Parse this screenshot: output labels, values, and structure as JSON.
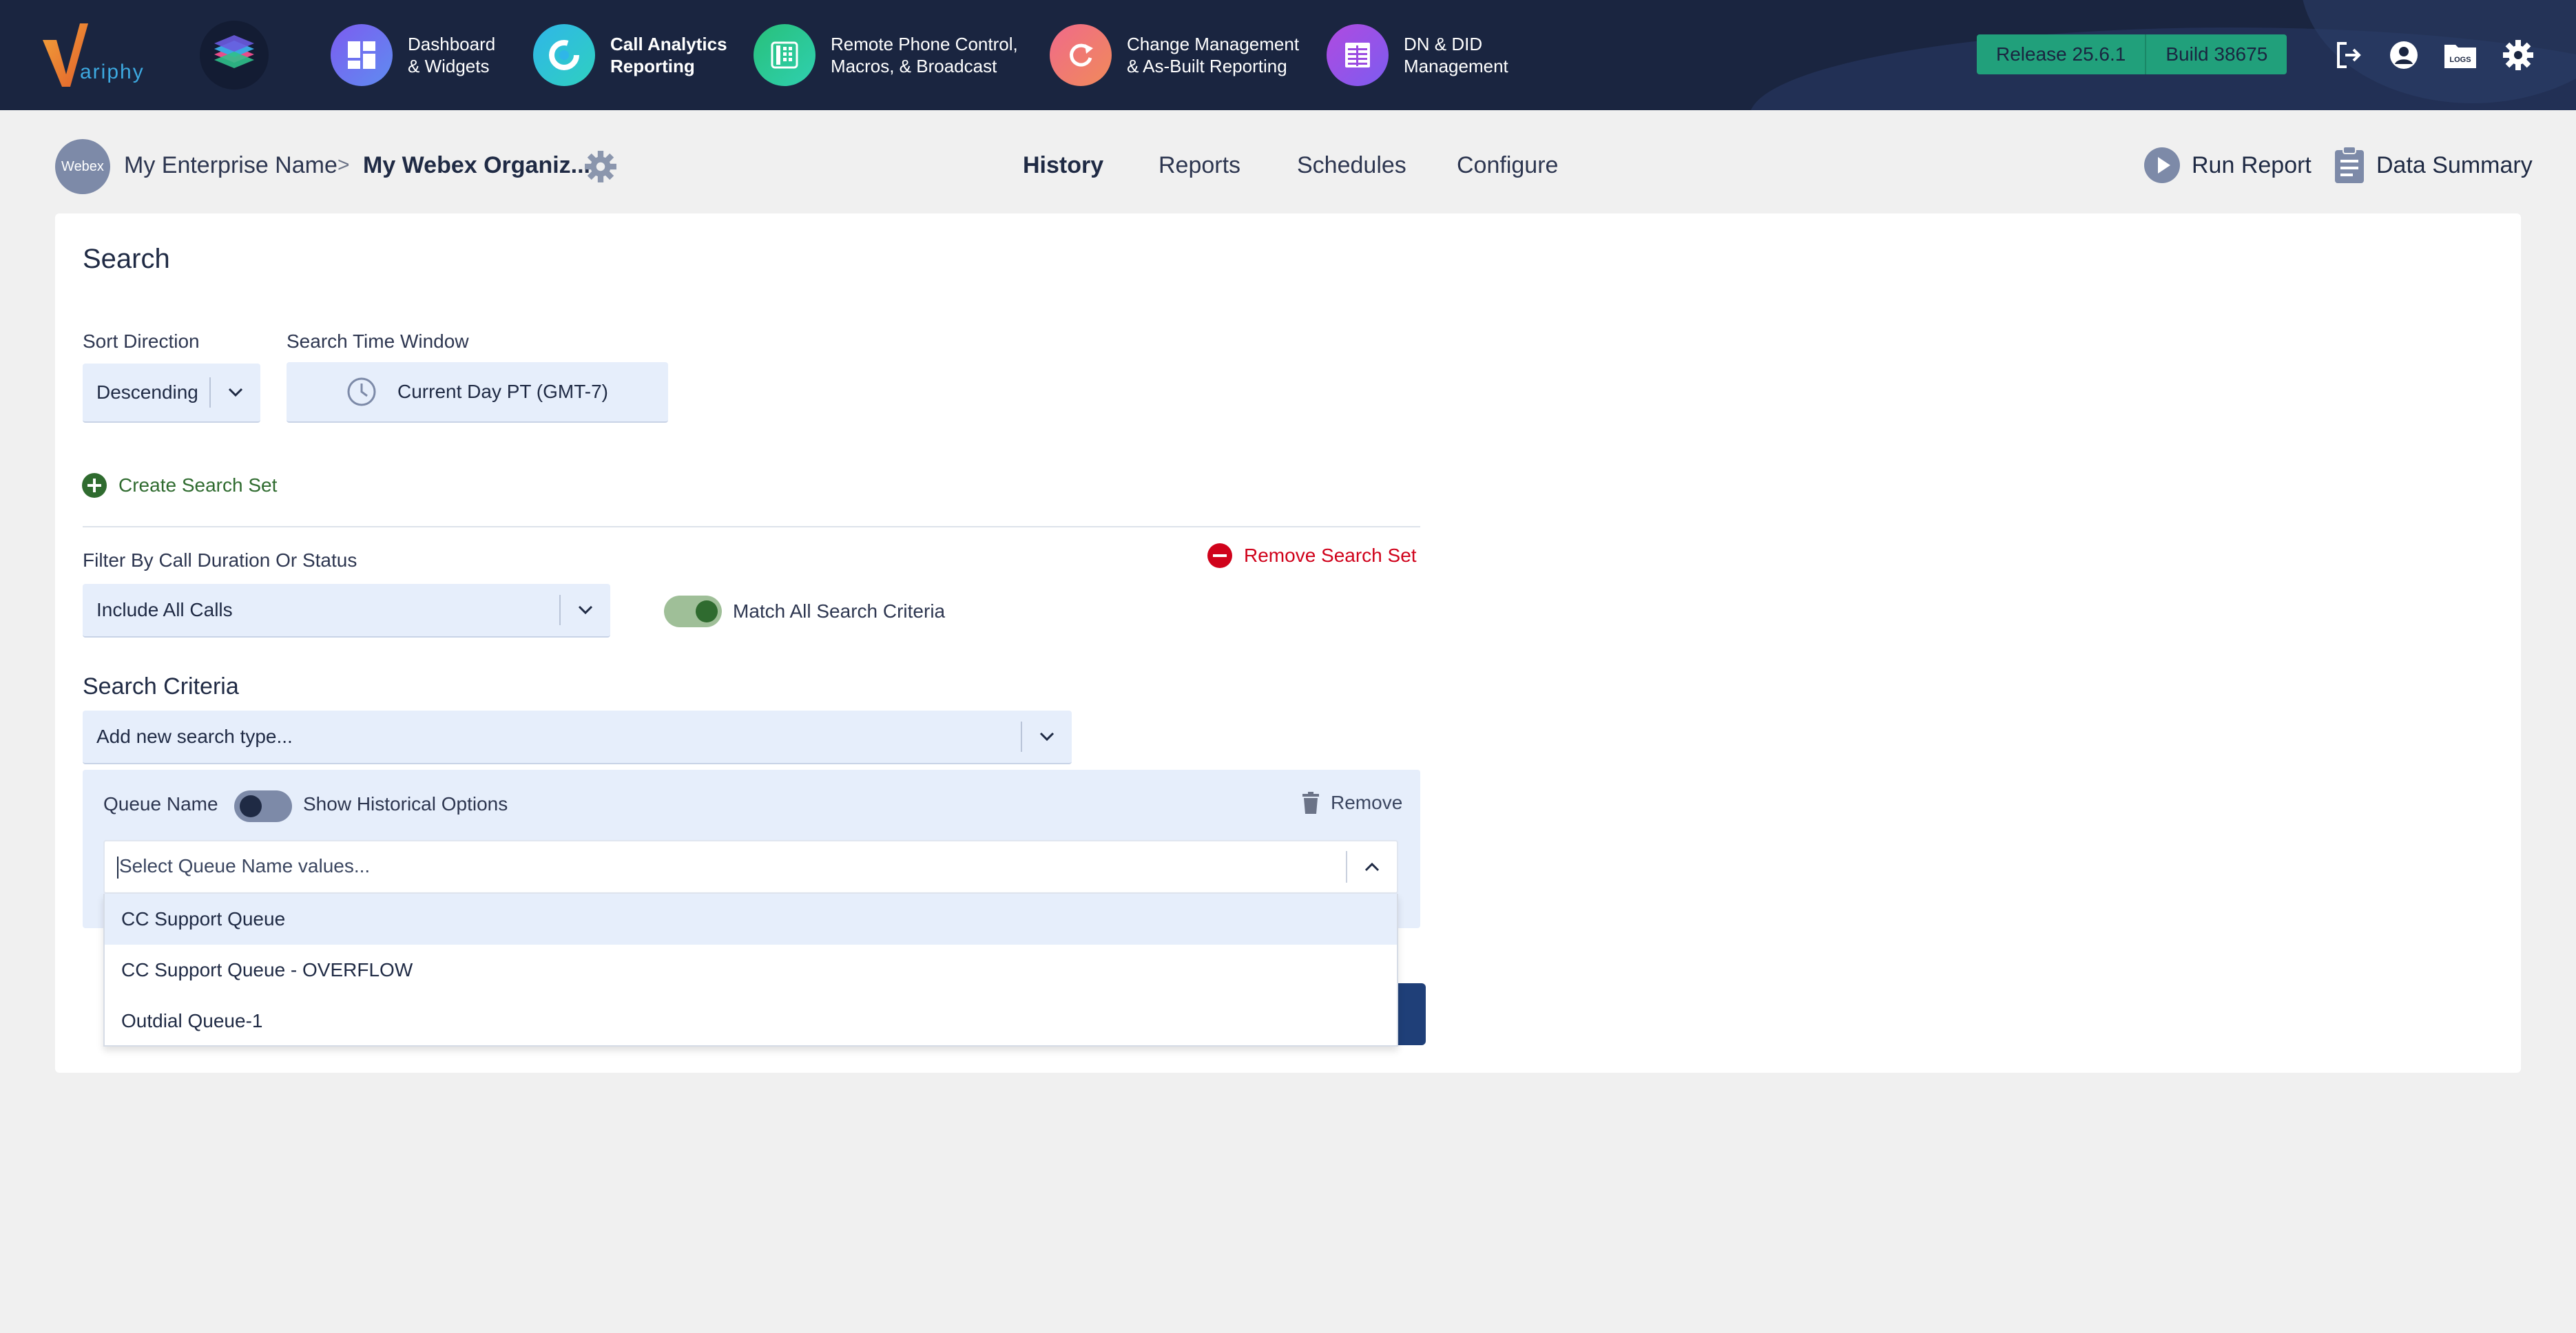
{
  "app": {
    "logo_text": "Variphy",
    "colors": {
      "nav_bg": "#1a2540",
      "accent_green": "#21a07b",
      "danger_red": "#d0021b",
      "link_green": "#2f6b2f"
    }
  },
  "nav": {
    "items": [
      {
        "label": "Dashboard\n& Widgets",
        "icon": "dashboard-icon",
        "active": false
      },
      {
        "label": "Call Analytics\nReporting",
        "icon": "call-analytics-icon",
        "active": true
      },
      {
        "label": "Remote Phone Control,\nMacros, & Broadcast",
        "icon": "phone-icon",
        "active": false
      },
      {
        "label": "Change Management\n& As-Built Reporting",
        "icon": "refresh-icon",
        "active": false
      },
      {
        "label": "DN & DID\nManagement",
        "icon": "table-icon",
        "active": false
      }
    ],
    "release": "Release 25.6.1",
    "build": "Build 38675",
    "icons": [
      "logout-icon",
      "user-icon",
      "logs-folder-icon",
      "settings-gear-icon"
    ],
    "logs_label": "LOGS"
  },
  "header": {
    "avatar": "Webex",
    "enterprise": "My Enterprise Name",
    "separator": ">",
    "organization": "My Webex Organiz...",
    "tabs": [
      "History",
      "Reports",
      "Schedules",
      "Configure"
    ],
    "active_tab": "History",
    "run_report": "Run Report",
    "data_summary": "Data Summary"
  },
  "search": {
    "title": "Search",
    "sort_direction_label": "Sort Direction",
    "sort_direction_value": "Descending",
    "time_window_label": "Search Time Window",
    "time_window_value": "Current Day PT (GMT-7)",
    "create_search_set": "Create Search Set",
    "remove_search_set": "Remove Search Set",
    "filter_label": "Filter By Call Duration Or Status",
    "filter_value": "Include All Calls",
    "match_all_label": "Match All Search Criteria",
    "match_all_on": true,
    "criteria_title": "Search Criteria",
    "add_type_placeholder": "Add new search type...",
    "criterion": {
      "name": "Queue Name",
      "historical_label": "Show Historical Options",
      "historical_on": false,
      "remove": "Remove",
      "values_placeholder": "Select Queue Name values...",
      "options": [
        "CC Support Queue",
        "CC Support Queue - OVERFLOW",
        "Outdial Queue-1"
      ],
      "highlighted_index": 0
    }
  }
}
